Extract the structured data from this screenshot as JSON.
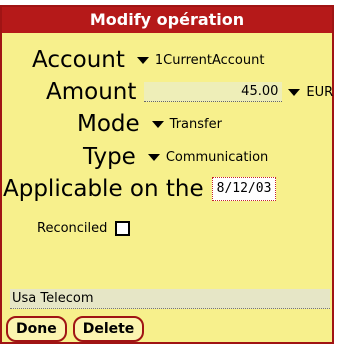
{
  "dialog": {
    "title": "Modify opération"
  },
  "form": {
    "account_label": "Account",
    "account_value": "1CurrentAccount",
    "amount_label": "Amount",
    "amount_value": "45.00",
    "currency_value": "EUR",
    "mode_label": "Mode",
    "mode_value": "Transfer",
    "type_label": "Type",
    "type_value": "Communication",
    "applicable_label": "Applicable on the",
    "applicable_date": "8/12/03",
    "reconciled_label": "Reconciled",
    "reconciled_checked": false,
    "note_text": "Usa Telecom"
  },
  "buttons": {
    "done_label": "Done",
    "delete_label": "Delete"
  },
  "colors": {
    "panel_background": "#f7f08c",
    "title_bar": "#b51919",
    "accent_border": "#a01414"
  }
}
